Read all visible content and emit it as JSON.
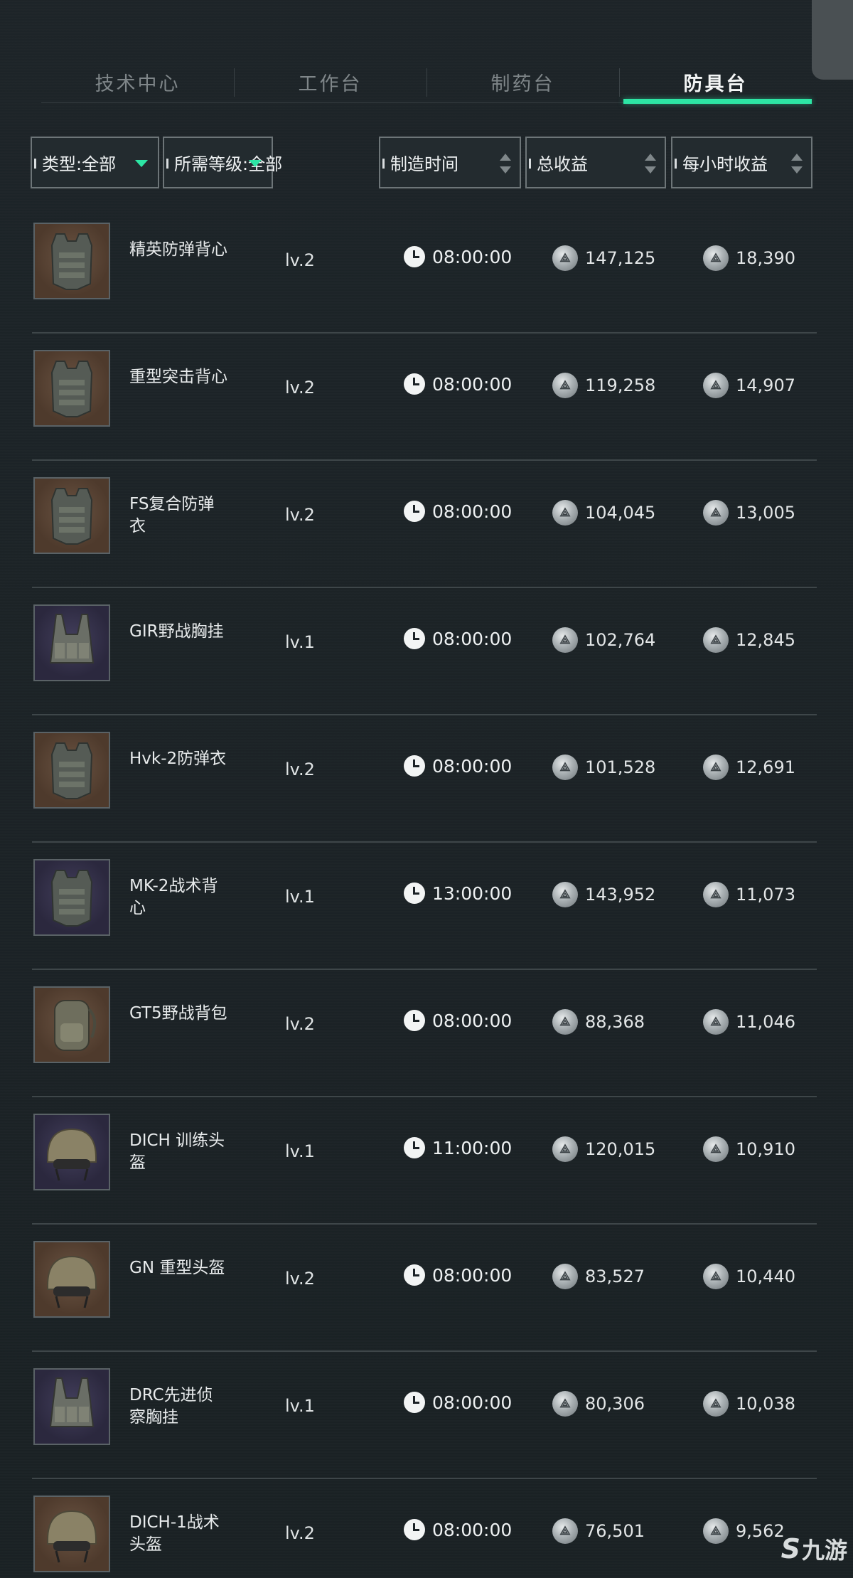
{
  "tabs": [
    {
      "label": "技术中心",
      "active": false
    },
    {
      "label": "工作台",
      "active": false
    },
    {
      "label": "制药台",
      "active": false
    },
    {
      "label": "防具台",
      "active": true
    }
  ],
  "filters": {
    "type": "类型:全部",
    "level": "所需等级:全部",
    "time": "制造时间",
    "total": "总收益",
    "hourly": "每小时收益"
  },
  "accent_color": "#2de6a5",
  "items": [
    {
      "name": "精英防弹背心",
      "level": "lv.2",
      "time": "08:00:00",
      "total": "147,125",
      "hourly": "18,390",
      "bg": "brown",
      "icon": "vest-icon"
    },
    {
      "name": "重型突击背心",
      "level": "lv.2",
      "time": "08:00:00",
      "total": "119,258",
      "hourly": "14,907",
      "bg": "brown",
      "icon": "vest-icon"
    },
    {
      "name": "FS复合防弹衣",
      "level": "lv.2",
      "time": "08:00:00",
      "total": "104,045",
      "hourly": "13,005",
      "bg": "brown",
      "icon": "vest-icon"
    },
    {
      "name": "GIR野战胸挂",
      "level": "lv.1",
      "time": "08:00:00",
      "total": "102,764",
      "hourly": "12,845",
      "bg": "purple",
      "icon": "chest-rig-icon"
    },
    {
      "name": "Hvk-2防弹衣",
      "level": "lv.2",
      "time": "08:00:00",
      "total": "101,528",
      "hourly": "12,691",
      "bg": "brown",
      "icon": "vest-icon"
    },
    {
      "name": "MK-2战术背心",
      "level": "lv.1",
      "time": "13:00:00",
      "total": "143,952",
      "hourly": "11,073",
      "bg": "purple",
      "icon": "vest-icon"
    },
    {
      "name": "GT5野战背包",
      "level": "lv.2",
      "time": "08:00:00",
      "total": "88,368",
      "hourly": "11,046",
      "bg": "brown",
      "icon": "backpack-icon"
    },
    {
      "name": "DICH 训练头盔",
      "level": "lv.1",
      "time": "11:00:00",
      "total": "120,015",
      "hourly": "10,910",
      "bg": "purple",
      "icon": "helmet-icon"
    },
    {
      "name": "GN 重型头盔",
      "level": "lv.2",
      "time": "08:00:00",
      "total": "83,527",
      "hourly": "10,440",
      "bg": "brown",
      "icon": "helmet-icon"
    },
    {
      "name": "DRC先进侦察胸挂",
      "level": "lv.1",
      "time": "08:00:00",
      "total": "80,306",
      "hourly": "10,038",
      "bg": "purple",
      "icon": "chest-rig-icon"
    },
    {
      "name": "DICH-1战术头盔",
      "level": "lv.2",
      "time": "08:00:00",
      "total": "76,501",
      "hourly": "9,562",
      "bg": "brown",
      "icon": "helmet-icon"
    }
  ],
  "watermark": {
    "mark": "S",
    "text": "九游"
  }
}
